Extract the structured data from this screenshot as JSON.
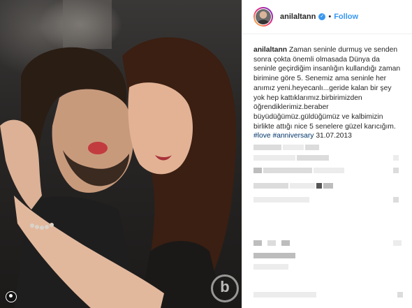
{
  "post": {
    "username": "anilaltann",
    "verified_glyph": "✓",
    "separator": "•",
    "follow_label": "Follow",
    "caption_username": "anilaltann",
    "caption_text": "Zaman seninle durmuş ve senden sonra çokta önemli olmasada Dünya da seninle geçirdiğim insanlığın kullandığı zaman birimine göre 5. Senemiz ama seninle her anımız yeni.heyecanlı...geride kalan bir şey yok hep kattıklarımız.birbirimizden öğrendiklerimiz.beraber büyüdüğümüz.güldüğümüz ve kalbimizin birlikte attığı nice 5 senelere güzel karıcığım.",
    "hashtags": [
      "#love",
      "#anniversary"
    ],
    "date": "31.07.2013"
  },
  "watermark": {
    "letter": "b"
  },
  "colors": {
    "link": "#3897f0",
    "hashtag": "#003569",
    "text": "#262626"
  },
  "icons": {
    "verified": "verified-badge-icon",
    "tag_people": "user-tag-icon"
  }
}
